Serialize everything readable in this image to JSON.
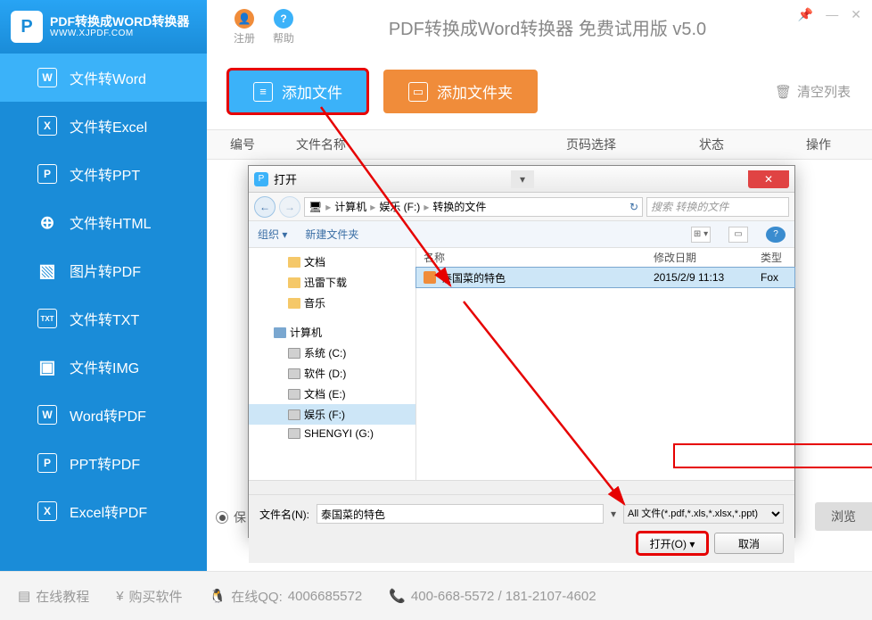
{
  "logo": {
    "badge": "P",
    "title": "PDF转换成WORD转换器",
    "subtitle": "WWW.XJPDF.COM"
  },
  "top": {
    "register": "注册",
    "help": "帮助",
    "app_title": "PDF转换成Word转换器 免费试用版 v5.0"
  },
  "sidebar": [
    {
      "icon": "W",
      "label": "文件转Word",
      "active": true
    },
    {
      "icon": "X",
      "label": "文件转Excel"
    },
    {
      "icon": "P",
      "label": "文件转PPT"
    },
    {
      "icon": "⊕",
      "label": "文件转HTML",
      "noborder": true
    },
    {
      "icon": "▧",
      "label": "图片转PDF",
      "noborder": true
    },
    {
      "icon": "TXT",
      "label": "文件转TXT"
    },
    {
      "icon": "▣",
      "label": "文件转IMG",
      "noborder": true
    },
    {
      "icon": "W",
      "label": "Word转PDF"
    },
    {
      "icon": "P",
      "label": "PPT转PDF"
    },
    {
      "icon": "X",
      "label": "Excel转PDF"
    }
  ],
  "toolbar": {
    "add_file": "添加文件",
    "add_folder": "添加文件夹",
    "clear": "清空列表"
  },
  "columns": {
    "index": "编号",
    "name": "文件名称",
    "pages": "页码选择",
    "status": "状态",
    "action": "操作"
  },
  "save_row": {
    "label": "保",
    "browse": "浏览"
  },
  "footer": {
    "tutorial": "在线教程",
    "buy": "购买软件",
    "qq_label": "在线QQ:",
    "qq": "4006685572",
    "phone": "400-668-5572 / 181-2107-4602"
  },
  "dialog": {
    "title": "打开",
    "breadcrumb": [
      "计算机",
      "娱乐 (F:)",
      "转换的文件"
    ],
    "search_placeholder": "搜索 转换的文件",
    "organize": "组织",
    "new_folder": "新建文件夹",
    "tree": [
      {
        "label": "文档",
        "type": "folder",
        "level": 2
      },
      {
        "label": "迅雷下载",
        "type": "folder",
        "level": 2
      },
      {
        "label": "音乐",
        "type": "folder",
        "level": 2
      },
      {
        "label": "计算机",
        "type": "computer",
        "level": 1,
        "gap": true
      },
      {
        "label": "系统 (C:)",
        "type": "drive",
        "level": 2
      },
      {
        "label": "软件 (D:)",
        "type": "drive",
        "level": 2
      },
      {
        "label": "文档 (E:)",
        "type": "drive",
        "level": 2
      },
      {
        "label": "娱乐 (F:)",
        "type": "drive",
        "level": 2,
        "selected": true
      },
      {
        "label": "SHENGYI (G:)",
        "type": "drive",
        "level": 2
      }
    ],
    "list_head": {
      "name": "名称",
      "date": "修改日期",
      "type": "类型"
    },
    "files": [
      {
        "name": "泰国菜的特色",
        "date": "2015/2/9 11:13",
        "type": "Fox",
        "selected": true
      }
    ],
    "filename_label": "文件名(N):",
    "filename_value": "泰国菜的特色",
    "filter": "All 文件(*.pdf,*.xls,*.xlsx,*.ppt)",
    "open_btn": "打开(O)",
    "cancel_btn": "取消"
  }
}
